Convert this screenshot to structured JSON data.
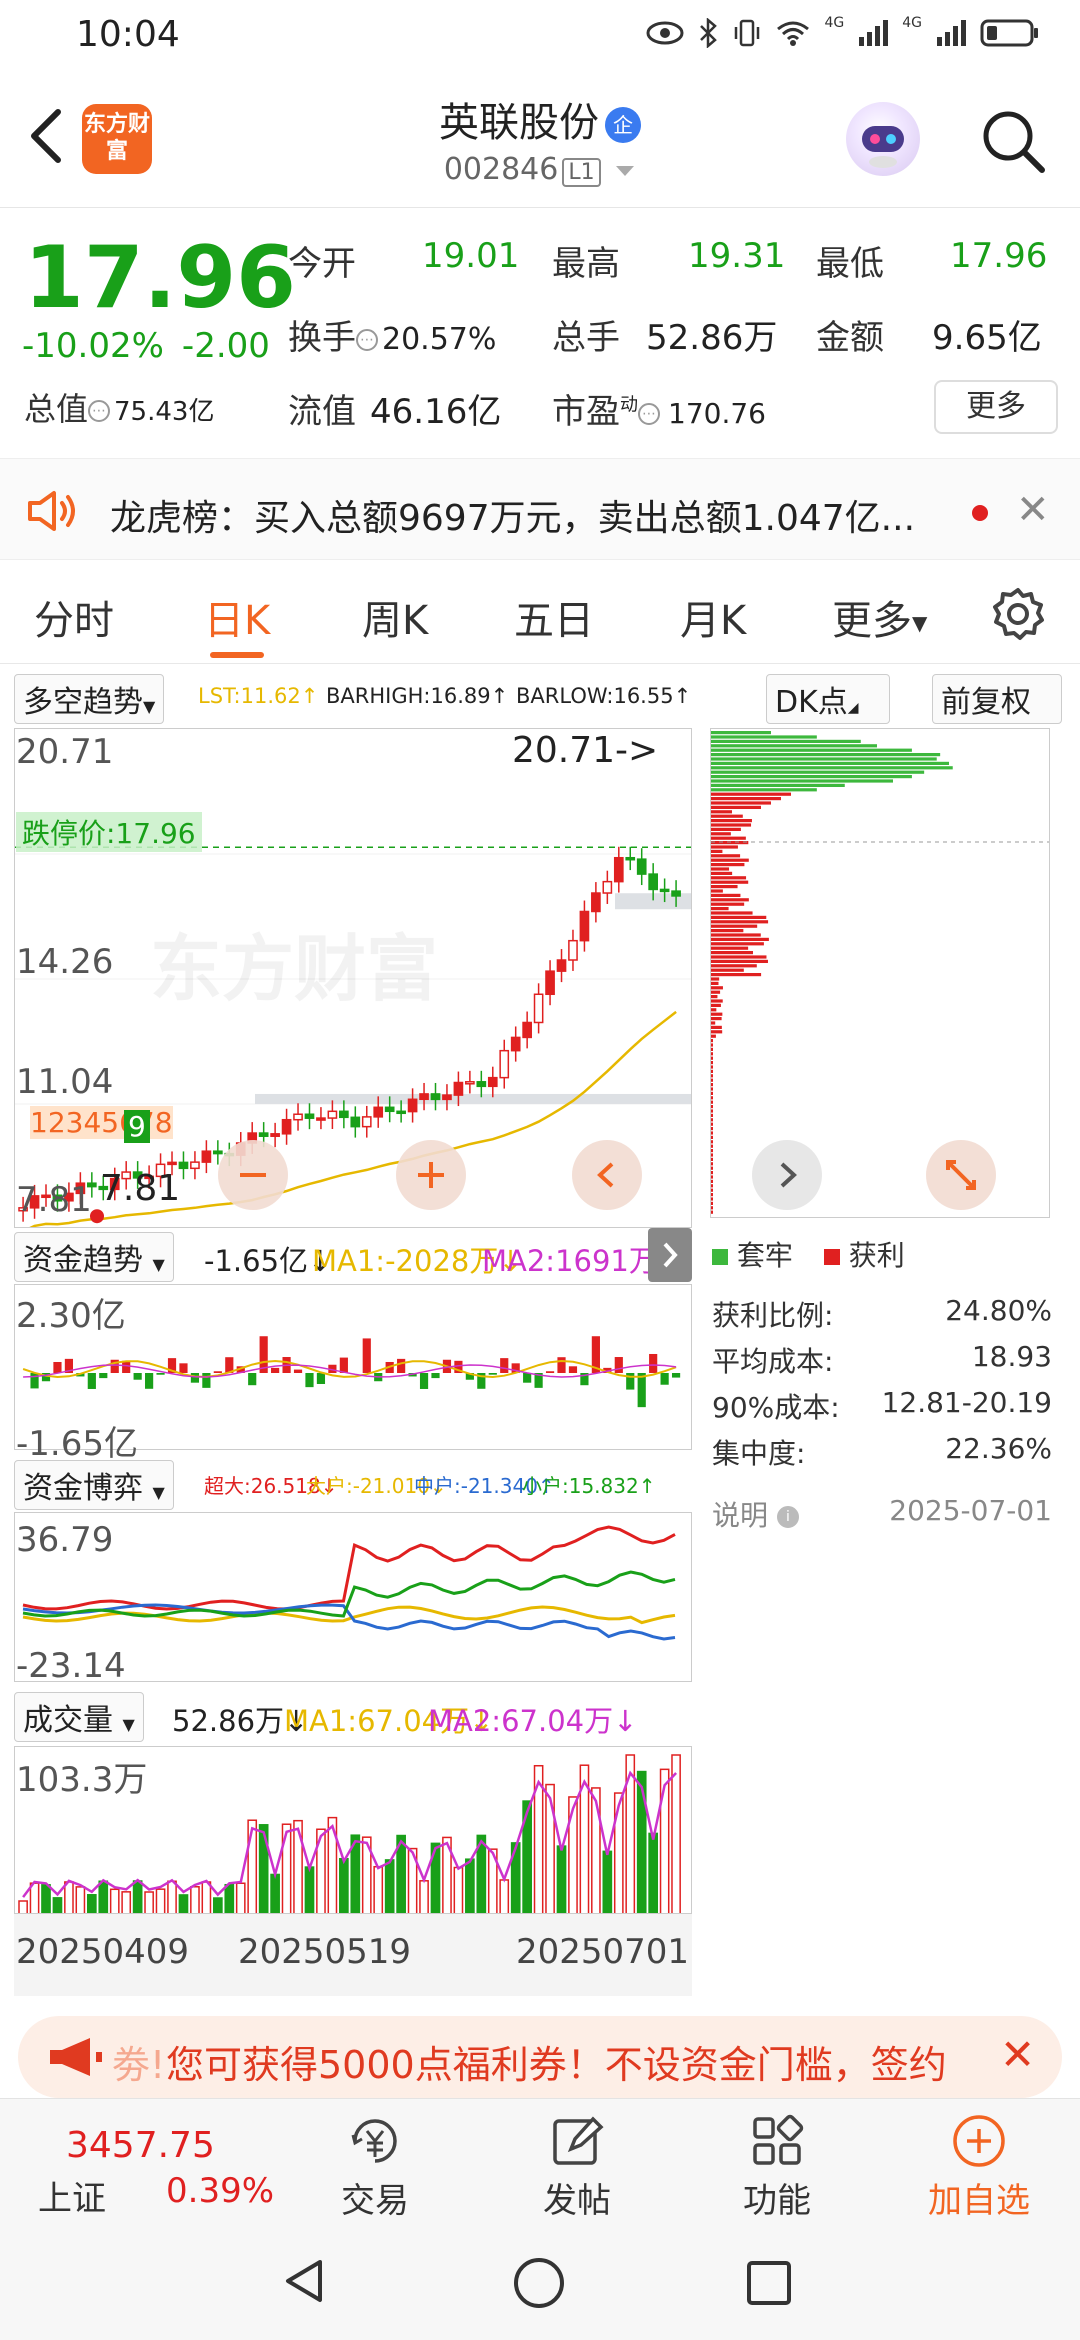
{
  "status_bar": {
    "time": "10:04",
    "signal_labels": [
      "4G",
      "4G"
    ]
  },
  "header": {
    "logo_text": "东方财富",
    "stock_name": "英联股份",
    "badge": "企",
    "stock_code": "002846",
    "level": "L1"
  },
  "quote": {
    "price": "17.96",
    "change_pct": "-10.02%",
    "change": "-2.00",
    "fields": {
      "open_label": "今开",
      "open": "19.01",
      "high_label": "最高",
      "high": "19.31",
      "low_label": "最低",
      "low": "17.96",
      "turnover_label": "换手",
      "turnover": "20.57%",
      "volume_label": "总手",
      "volume": "52.86万",
      "amount_label": "金额",
      "amount": "9.65亿",
      "mktcap_label": "总值",
      "mktcap": "75.43亿",
      "float_label": "流值",
      "float": "46.16亿",
      "pe_label": "市盈",
      "pe_sup": "动",
      "pe": "170.76"
    },
    "more_button": "更多"
  },
  "ticker": {
    "text": "龙虎榜：买入总额9697万元，卖出总额1.047亿..."
  },
  "tabs": [
    "分时",
    "日K",
    "周K",
    "五日",
    "月K",
    "更多"
  ],
  "kline": {
    "indicator": "多空趋势",
    "lst": "LST:11.62↑",
    "barhigh": "BARHIGH:16.89↑",
    "barlow": "BARLOW:16.55↑",
    "dk_button": "DK点",
    "adjust_button": "前复权",
    "axis": [
      "20.71",
      "14.26",
      "11.04",
      "7.81"
    ],
    "limit_down_label": "跌停价:17.96",
    "high_marker": "20.71->",
    "low_marker": "7.81",
    "watermark": "东方财富",
    "signal_digits": "12345678",
    "signal_last": "9"
  },
  "chip": {
    "legend_trapped": "套牢",
    "legend_profit": "获利",
    "stats": [
      {
        "label": "获利比例:",
        "value": "24.80%"
      },
      {
        "label": "平均成本:",
        "value": "18.93"
      },
      {
        "label": "90%成本:",
        "value": "12.81-20.19"
      },
      {
        "label": "集中度:",
        "value": "22.36%"
      }
    ],
    "note_label": "说明",
    "date": "2025-07-01"
  },
  "fund_trend": {
    "title": "资金趋势",
    "value": "-1.65亿↓",
    "ma1": "MA1:-2028万↓",
    "ma2": "MA2:1691万↓",
    "axis_top": "2.30亿",
    "axis_bottom": "-1.65亿"
  },
  "fund_game": {
    "title": "资金博弈",
    "super": "超大:26.518↓",
    "large": "大户:-21.010↓",
    "mid": "中户:-21.340↑",
    "small": "小户:15.832↑",
    "axis_top": "36.79",
    "axis_bottom": "-23.14"
  },
  "volume": {
    "title": "成交量",
    "value": "52.86万↓",
    "ma1": "MA1:67.04万↓",
    "ma2": "MA2:67.04万↓",
    "axis_top": "103.3万",
    "dates": [
      "20250409",
      "20250519",
      "20250701"
    ]
  },
  "promo": {
    "text": "您可获得5000点福利券！不设资金门槛，签约"
  },
  "bottom_nav": {
    "index_value": "3457.75",
    "index_name": "上证",
    "index_change": "0.39%",
    "items": [
      "交易",
      "发帖",
      "功能",
      "加自选"
    ]
  },
  "colors": {
    "up": "#e02020",
    "down": "#19a019",
    "accent": "#f26522",
    "ma_yellow": "#e6b800",
    "ma_magenta": "#cc33cc",
    "blue": "#2a6ad0"
  }
}
